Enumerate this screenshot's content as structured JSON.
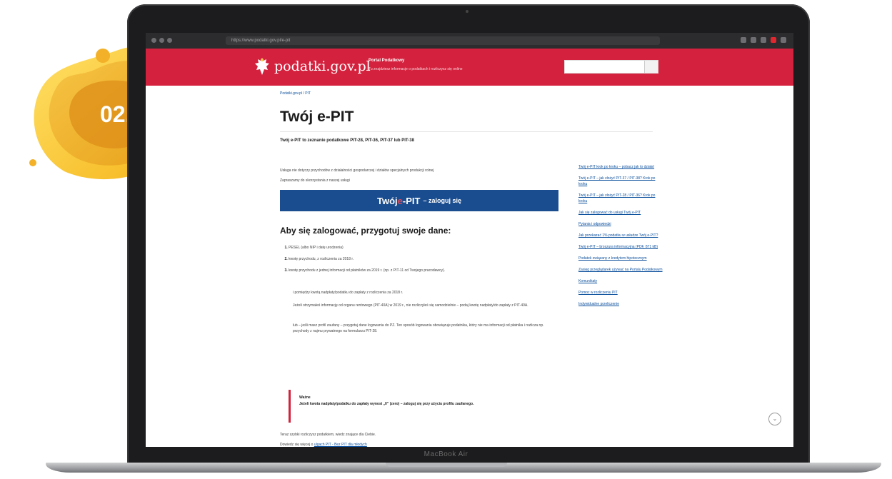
{
  "badge": {
    "label": "02."
  },
  "device": {
    "model_label": "MacBook Air"
  },
  "browser": {
    "url_text": "https://www.podatki.gov.pl/e-pit"
  },
  "site": {
    "logo_text": "podatki.gov.pl",
    "portal_name": "Portal Podatkowy",
    "portal_tagline": "Tu znajdziesz informacje o podatkach i rozliczysz się online",
    "brand_color": "#d4213d"
  },
  "page": {
    "breadcrumb": "Podatki.gov.pl / PIT",
    "title": "Twój e-PIT",
    "lead": "Twój e-PIT to zeznanie podatkowe PIT-28, PIT-36, PIT-37 lub PIT-38",
    "intro1": "Usługa nie dotyczy przychodów z działalności gospodarczej i działów specjalnych produkcji rolnej",
    "intro2": "Zapraszamy do skorzystania z naszej usługi",
    "login": {
      "twoj": "Twój ",
      "e": "e",
      "pit": "-PIT",
      "action": "– zaloguj się"
    },
    "section_heading": "Aby się zalogować, przygotuj swoje dane:",
    "steps": [
      "PESEL (albo NIP i datę urodzenia)",
      "kwotę przychodu, z rozliczenia za 2018 r.",
      "kwotę przychodu z jednej informacji od płatników za 2019 r. (np. z PIT-11 od Twojego pracodawcy)."
    ],
    "para1": "i pomiędzy kwotą nadpłaty/podatku do zapłaty z rozliczenia za 2018 r.",
    "para2": "Jeżeli otrzymałeś informację od organu rentowego (PIT-40A) w 2019 r., nie rozliczyłeś się samodzielnie – podaj kwotę nadpłaty/do zapłaty z PIT-40A.",
    "para3": "lub – jeśli masz profil zaufany – przygotuj dane logowania do PZ. Ten sposób logowania obowiązuje podatnika, który nie ma informacji od płatnika i rozlicza np. przychody z najmu prywatnego na formularzu PIT-28.",
    "note_heading": "Ważne",
    "note_text": "Jeżeli kwota nadpłaty/podatku do zapłaty wynosi „0” (zero) – zaloguj się przy użyciu profilu zaufanego.",
    "closing1": "Teraz szybki rozliczysz podatkiem, wiedz znające dla Ciebie.",
    "closing2_prefix": "Dowiedz się więcej o ",
    "closing2_link": "ulgach PIT - Bez PIT dla młodych"
  },
  "side_nav": {
    "items": [
      "Twój e-PIT krok po kroku – pobacz jak to działa!",
      "Twój e-PIT – jak złożyć PIT-37 / PIT-38? Krok po kroku",
      "Twój e-PIT – jak złożyć PIT-28 / PIT-36? Krok po kroku",
      "Jak się zalogować do usługi Twój e-PIT",
      "Pytania i odpowiedzi",
      "Jak przekazać 1% podatku w usłudze Twój e-PIT?",
      "Twój e-PIT – broszura informacyjna (PDF, 871 kB)",
      "Podatek związany z kredytem hipotecznym",
      "Zasięg przeglądarek używać na Portalu Podatkowym",
      "Komunikaty",
      "Pomoc w rozliczeniu PIT",
      "Indywidualne przeliczenie"
    ]
  }
}
